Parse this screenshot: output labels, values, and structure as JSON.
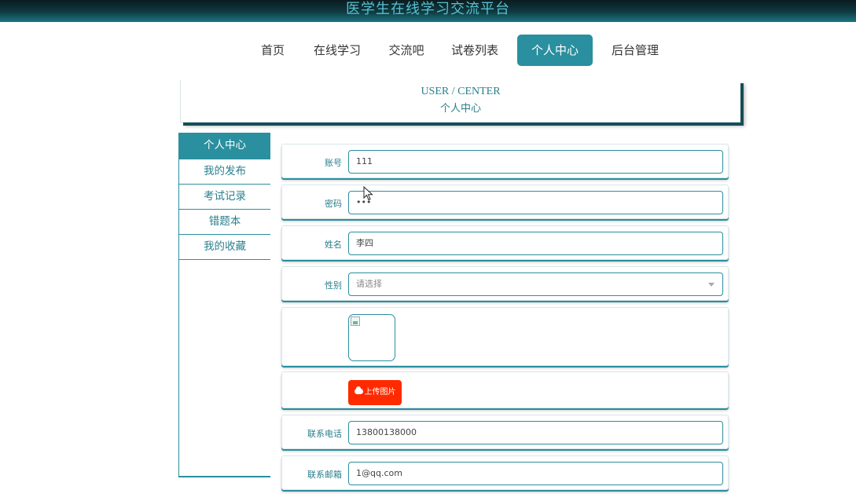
{
  "app": {
    "title": "医学生在线学习交流平台"
  },
  "nav": {
    "items": [
      "首页",
      "在线学习",
      "交流吧",
      "试卷列表",
      "个人中心",
      "后台管理"
    ],
    "active": "个人中心"
  },
  "header": {
    "en": "USER / CENTER",
    "cn": "个人中心"
  },
  "sidebar": {
    "items": [
      "个人中心",
      "我的发布",
      "考试记录",
      "错题本",
      "我的收藏"
    ]
  },
  "form": {
    "account": {
      "label": "账号",
      "value": "111"
    },
    "password": {
      "label": "密码",
      "value": "•••"
    },
    "name": {
      "label": "姓名",
      "value": "李四"
    },
    "gender": {
      "label": "性别",
      "placeholder": "请选择"
    },
    "upload": {
      "label": "上传图片"
    },
    "phone": {
      "label": "联系电话",
      "value": "13800138000"
    },
    "email": {
      "label": "联系邮箱",
      "value": "1@qq.com"
    }
  },
  "colors": {
    "accent": "#2a8f9e",
    "upload": "#ff2a00"
  }
}
